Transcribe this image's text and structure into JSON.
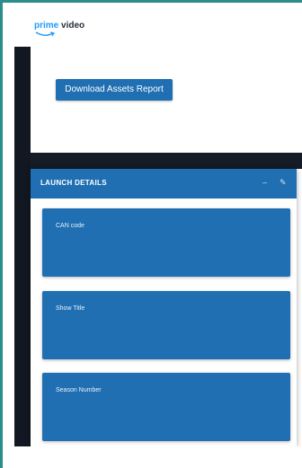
{
  "header": {
    "logo_prime": "prime",
    "logo_video": "video"
  },
  "actions": {
    "download_label": "Download Assets Report"
  },
  "launch_details": {
    "title": "LAUNCH DETAILS",
    "minimize_icon": "minus-icon",
    "edit_icon": "pencil-icon",
    "fields": [
      {
        "label": "CAN code"
      },
      {
        "label": "Show Title"
      },
      {
        "label": "Season Number"
      }
    ]
  },
  "colors": {
    "accent": "#1f6fb2",
    "frame": "#2a8f8b",
    "dark": "#111821",
    "logo_blue": "#1a98ff"
  }
}
